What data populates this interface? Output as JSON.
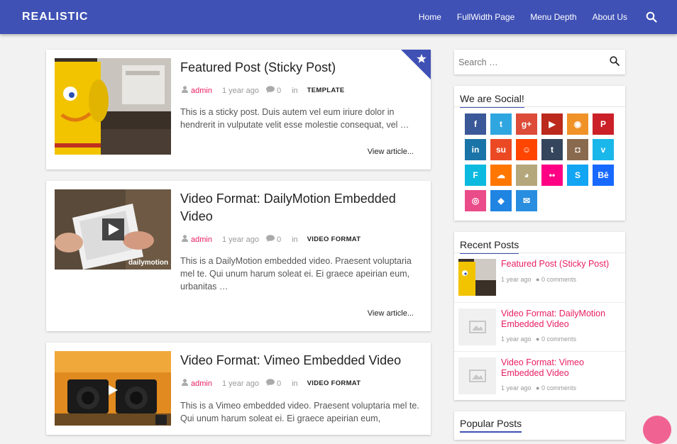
{
  "header": {
    "brand": "REALISTIC",
    "nav": [
      "Home",
      "FullWidth Page",
      "Menu Depth",
      "About Us"
    ],
    "accent": "#3f51b5",
    "link_color": "#e91e63"
  },
  "posts": [
    {
      "title": "Featured Post (Sticky Post)",
      "author": "admin",
      "date": "1 year ago",
      "comments": "0",
      "in": "in",
      "category": "TEMPLATE",
      "excerpt": "This is a sticky post. Duis autem vel eum iriure dolor in hendrerit in vulputate velit esse molestie consequat, vel …",
      "more": "View article...",
      "sticky": true
    },
    {
      "title": "Video Format: DailyMotion Embedded Video",
      "author": "admin",
      "date": "1 year ago",
      "comments": "0",
      "in": "in",
      "category": "VIDEO FORMAT",
      "excerpt": "This is a DailyMotion embedded video. Praesent voluptaria mel te. Qui unum harum soleat ei. Ei graece apeirian eum, urbanitas …",
      "more": "View article...",
      "watermark": "dailymotion"
    },
    {
      "title": "Video Format: Vimeo Embedded Video",
      "author": "admin",
      "date": "1 year ago",
      "comments": "0",
      "in": "in",
      "category": "VIDEO FORMAT",
      "excerpt": "This is a Vimeo embedded video. Praesent voluptaria mel te. Qui unum harum soleat ei. Ei graece apeirian eum,"
    }
  ],
  "sidebar": {
    "search_placeholder": "Search …",
    "social_title": "We are Social!",
    "social": [
      {
        "icon": "facebook-icon",
        "glyph": "f",
        "color": "#3b5998"
      },
      {
        "icon": "twitter-icon",
        "glyph": "t",
        "color": "#2fa6e0"
      },
      {
        "icon": "google-plus-icon",
        "glyph": "g+",
        "color": "#dd4b39"
      },
      {
        "icon": "youtube-icon",
        "glyph": "▶",
        "color": "#bb2a1c"
      },
      {
        "icon": "rss-icon",
        "glyph": "◉",
        "color": "#f09228"
      },
      {
        "icon": "pinterest-icon",
        "glyph": "P",
        "color": "#cb2027"
      },
      {
        "icon": "linkedin-icon",
        "glyph": "in",
        "color": "#1a74a8"
      },
      {
        "icon": "stumbleupon-icon",
        "glyph": "su",
        "color": "#eb4924"
      },
      {
        "icon": "reddit-icon",
        "glyph": "☺",
        "color": "#ff4500"
      },
      {
        "icon": "tumblr-icon",
        "glyph": "t",
        "color": "#35465c"
      },
      {
        "icon": "instagram-icon",
        "glyph": "◘",
        "color": "#8a6a4e"
      },
      {
        "icon": "vimeo-icon",
        "glyph": "v",
        "color": "#1ab7ea"
      },
      {
        "icon": "foursquare-icon",
        "glyph": "F",
        "color": "#0cbadf"
      },
      {
        "icon": "soundcloud-icon",
        "glyph": "☁",
        "color": "#ff7700"
      },
      {
        "icon": "github-icon",
        "glyph": "◕",
        "color": "#b5a77c"
      },
      {
        "icon": "flickr-icon",
        "glyph": "••",
        "color": "#ff0084"
      },
      {
        "icon": "skype-icon",
        "glyph": "S",
        "color": "#12a5f4"
      },
      {
        "icon": "behance-icon",
        "glyph": "Bē",
        "color": "#1769ff"
      },
      {
        "icon": "dribbble-icon",
        "glyph": "◎",
        "color": "#ea4c89"
      },
      {
        "icon": "dropbox-icon",
        "glyph": "◆",
        "color": "#1f84e2"
      },
      {
        "icon": "email-icon",
        "glyph": "✉",
        "color": "#2a8ee0"
      }
    ],
    "recent_title": "Recent Posts",
    "recent": [
      {
        "title": "Featured Post (Sticky Post)",
        "date": "1 year ago",
        "comments": "0 comments"
      },
      {
        "title": "Video Format: DailyMotion Embedded Video",
        "date": "1 year ago",
        "comments": "0 comments"
      },
      {
        "title": "Video Format: Vimeo Embedded Video",
        "date": "1 year ago",
        "comments": "0 comments"
      }
    ],
    "popular_title": "Popular Posts"
  }
}
